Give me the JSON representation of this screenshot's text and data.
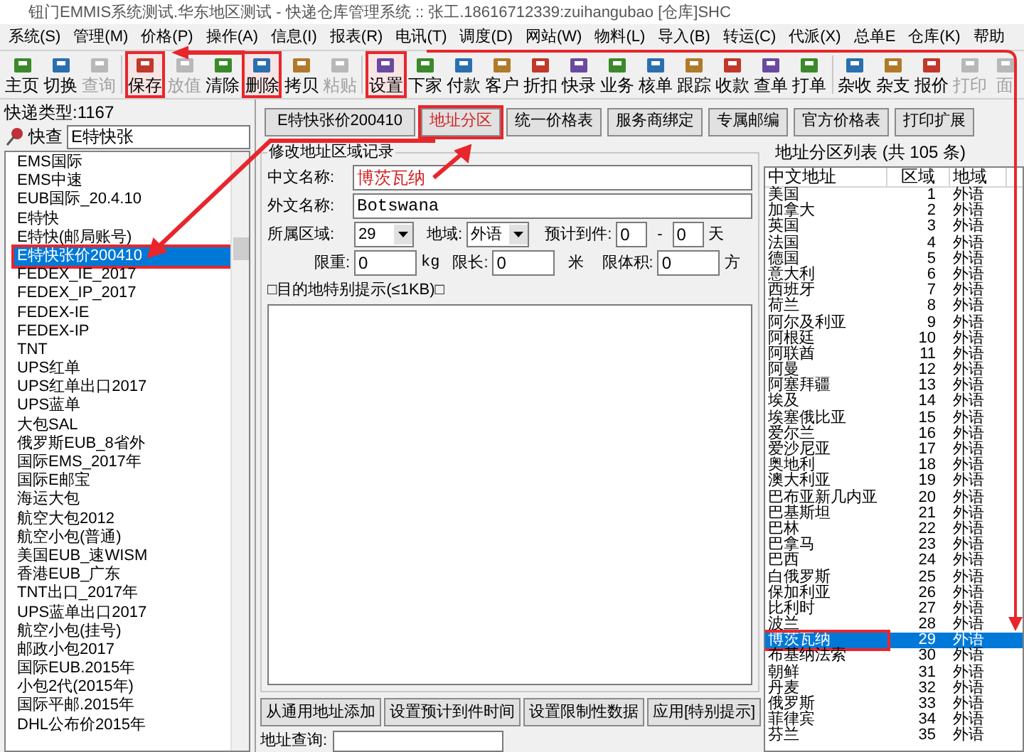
{
  "window": {
    "title": "钮门EMMIS系统测试.华东地区测试 - 快递仓库管理系统 :: 张工.18616712339:zuihangubao [仓库]SHC"
  },
  "menu": [
    "系统(S)",
    "管理(M)",
    "价格(P)",
    "操作(A)",
    "信息(I)",
    "报表(R)",
    "电讯(T)",
    "调度(D)",
    "网站(W)",
    "物料(L)",
    "导入(B)",
    "转运(C)",
    "代派(X)",
    "总单E",
    "仓库(K)",
    "帮助"
  ],
  "toolbar": [
    {
      "label": "主页",
      "disabled": false,
      "highlighted": false
    },
    {
      "label": "切换",
      "disabled": false,
      "highlighted": false
    },
    {
      "label": "查询",
      "disabled": true,
      "highlighted": false
    },
    {
      "label": "保存",
      "disabled": false,
      "highlighted": true
    },
    {
      "label": "放值",
      "disabled": true,
      "highlighted": false
    },
    {
      "label": "清除",
      "disabled": false,
      "highlighted": false
    },
    {
      "label": "删除",
      "disabled": false,
      "highlighted": true
    },
    {
      "label": "拷贝",
      "disabled": false,
      "highlighted": false
    },
    {
      "label": "粘贴",
      "disabled": true,
      "highlighted": false
    },
    {
      "label": "设置",
      "disabled": false,
      "highlighted": true
    },
    {
      "label": "下家",
      "disabled": false,
      "highlighted": false
    },
    {
      "label": "付款",
      "disabled": false,
      "highlighted": false
    },
    {
      "label": "客户",
      "disabled": false,
      "highlighted": false
    },
    {
      "label": "折扣",
      "disabled": false,
      "highlighted": false
    },
    {
      "label": "快录",
      "disabled": false,
      "highlighted": false
    },
    {
      "label": "业务",
      "disabled": false,
      "highlighted": false
    },
    {
      "label": "核单",
      "disabled": false,
      "highlighted": false
    },
    {
      "label": "跟踪",
      "disabled": false,
      "highlighted": false
    },
    {
      "label": "收款",
      "disabled": false,
      "highlighted": false
    },
    {
      "label": "查单",
      "disabled": false,
      "highlighted": false
    },
    {
      "label": "打单",
      "disabled": false,
      "highlighted": false
    },
    {
      "label": "杂收",
      "disabled": false,
      "highlighted": false
    },
    {
      "label": "杂支",
      "disabled": false,
      "highlighted": false
    },
    {
      "label": "报价",
      "disabled": false,
      "highlighted": false
    },
    {
      "label": "打印",
      "disabled": true,
      "highlighted": false
    },
    {
      "label": "面",
      "disabled": true,
      "highlighted": false
    }
  ],
  "left_panel": {
    "count_label": "快递类型:1167",
    "search_label": "快查",
    "search_value": "E特快张",
    "items": [
      {
        "label": "EMS国际",
        "selected": false
      },
      {
        "label": "EMS中速",
        "selected": false
      },
      {
        "label": "EUB国际_20.4.10",
        "selected": false
      },
      {
        "label": "E特快",
        "selected": false
      },
      {
        "label": "E特快(邮局账号)",
        "selected": false
      },
      {
        "label": "E特快张价200410",
        "selected": true
      },
      {
        "label": "FEDEX_IE_2017",
        "selected": false
      },
      {
        "label": "FEDEX_IP_2017",
        "selected": false
      },
      {
        "label": "FEDEX-IE",
        "selected": false
      },
      {
        "label": "FEDEX-IP",
        "selected": false
      },
      {
        "label": "TNT",
        "selected": false
      },
      {
        "label": "UPS红单",
        "selected": false
      },
      {
        "label": "UPS红单出口2017",
        "selected": false
      },
      {
        "label": "UPS蓝单",
        "selected": false
      },
      {
        "label": "大包SAL",
        "selected": false
      },
      {
        "label": "俄罗斯EUB_8省外",
        "selected": false
      },
      {
        "label": "国际EMS_2017年",
        "selected": false
      },
      {
        "label": "国际E邮宝",
        "selected": false
      },
      {
        "label": "海运大包",
        "selected": false
      },
      {
        "label": "航空大包2012",
        "selected": false
      },
      {
        "label": "航空小包(普通)",
        "selected": false
      },
      {
        "label": "美国EUB_速WISM",
        "selected": false
      },
      {
        "label": "香港EUB_广东",
        "selected": false
      },
      {
        "label": "TNT出口_2017年",
        "selected": false
      },
      {
        "label": "UPS蓝单出口2017",
        "selected": false
      },
      {
        "label": "航空小包(挂号)",
        "selected": false
      },
      {
        "label": "邮政小包2017",
        "selected": false
      },
      {
        "label": "国际EUB.2015年",
        "selected": false
      },
      {
        "label": "小包2代(2015年)",
        "selected": false
      },
      {
        "label": "国际平邮.2015年",
        "selected": false
      },
      {
        "label": "DHL公布价2015年",
        "selected": false
      }
    ]
  },
  "tabs": [
    {
      "label": "E特快张价200410",
      "selected": false
    },
    {
      "label": "地址分区",
      "selected": true
    },
    {
      "label": "统一价格表",
      "selected": false
    },
    {
      "label": "服务商绑定",
      "selected": false
    },
    {
      "label": "专属邮编",
      "selected": false
    },
    {
      "label": "官方价格表",
      "selected": false
    },
    {
      "label": "打印扩展",
      "selected": false
    }
  ],
  "form": {
    "title": "修改地址区域记录",
    "cn_name": {
      "label": "中文名称:",
      "value": "博茨瓦纳"
    },
    "en_name": {
      "label": "外文名称:",
      "value": "Botswana"
    },
    "zone": {
      "label": "所属区域:",
      "value": "29"
    },
    "region": {
      "label": "地域:",
      "value": "外语"
    },
    "eta": {
      "label": "预计到件:",
      "from": "0",
      "separator": "-",
      "to": "0",
      "unit": "天"
    },
    "weight": {
      "label": "限重:",
      "value": "0",
      "unit": "kg"
    },
    "length": {
      "label": "限长:",
      "value": "0",
      "unit": "米"
    },
    "volume": {
      "label": "限体积:",
      "value": "0",
      "unit": "方"
    },
    "note_label": "□目的地特别提示(≤1KB)□"
  },
  "actions": [
    "从通用地址添加",
    "设置预计到件时间",
    "设置限制性数据",
    "应用[特别提示]"
  ],
  "lookup": {
    "label": "地址查询:"
  },
  "zone_list": {
    "title": "地址分区列表 (共 105 条)",
    "columns": [
      "中文地址",
      "区域",
      "地域"
    ],
    "rows": [
      {
        "name": "美国",
        "zone": "1",
        "region": "外语",
        "selected": false
      },
      {
        "name": "加拿大",
        "zone": "2",
        "region": "外语",
        "selected": false
      },
      {
        "name": "英国",
        "zone": "3",
        "region": "外语",
        "selected": false
      },
      {
        "name": "法国",
        "zone": "4",
        "region": "外语",
        "selected": false
      },
      {
        "name": "德国",
        "zone": "5",
        "region": "外语",
        "selected": false
      },
      {
        "name": "意大利",
        "zone": "6",
        "region": "外语",
        "selected": false
      },
      {
        "name": "西班牙",
        "zone": "7",
        "region": "外语",
        "selected": false
      },
      {
        "name": "荷兰",
        "zone": "8",
        "region": "外语",
        "selected": false
      },
      {
        "name": "阿尔及利亚",
        "zone": "9",
        "region": "外语",
        "selected": false
      },
      {
        "name": "阿根廷",
        "zone": "10",
        "region": "外语",
        "selected": false
      },
      {
        "name": "阿联酋",
        "zone": "11",
        "region": "外语",
        "selected": false
      },
      {
        "name": "阿曼",
        "zone": "12",
        "region": "外语",
        "selected": false
      },
      {
        "name": "阿塞拜疆",
        "zone": "13",
        "region": "外语",
        "selected": false
      },
      {
        "name": "埃及",
        "zone": "14",
        "region": "外语",
        "selected": false
      },
      {
        "name": "埃塞俄比亚",
        "zone": "15",
        "region": "外语",
        "selected": false
      },
      {
        "name": "爱尔兰",
        "zone": "16",
        "region": "外语",
        "selected": false
      },
      {
        "name": "爱沙尼亚",
        "zone": "17",
        "region": "外语",
        "selected": false
      },
      {
        "name": "奥地利",
        "zone": "18",
        "region": "外语",
        "selected": false
      },
      {
        "name": "澳大利亚",
        "zone": "19",
        "region": "外语",
        "selected": false
      },
      {
        "name": "巴布亚新几内亚",
        "zone": "20",
        "region": "外语",
        "selected": false
      },
      {
        "name": "巴基斯坦",
        "zone": "21",
        "region": "外语",
        "selected": false
      },
      {
        "name": "巴林",
        "zone": "22",
        "region": "外语",
        "selected": false
      },
      {
        "name": "巴拿马",
        "zone": "23",
        "region": "外语",
        "selected": false
      },
      {
        "name": "巴西",
        "zone": "24",
        "region": "外语",
        "selected": false
      },
      {
        "name": "白俄罗斯",
        "zone": "25",
        "region": "外语",
        "selected": false
      },
      {
        "name": "保加利亚",
        "zone": "26",
        "region": "外语",
        "selected": false
      },
      {
        "name": "比利时",
        "zone": "27",
        "region": "外语",
        "selected": false
      },
      {
        "name": "波兰",
        "zone": "28",
        "region": "外语",
        "selected": false
      },
      {
        "name": "博茨瓦纳",
        "zone": "29",
        "region": "外语",
        "selected": true
      },
      {
        "name": "布基纳法索",
        "zone": "30",
        "region": "外语",
        "selected": false
      },
      {
        "name": "朝鲜",
        "zone": "31",
        "region": "外语",
        "selected": false
      },
      {
        "name": "丹麦",
        "zone": "32",
        "region": "外语",
        "selected": false
      },
      {
        "name": "俄罗斯",
        "zone": "33",
        "region": "外语",
        "selected": false
      },
      {
        "name": "菲律宾",
        "zone": "34",
        "region": "外语",
        "selected": false
      },
      {
        "name": "芬兰",
        "zone": "35",
        "region": "外语",
        "selected": false
      }
    ]
  }
}
